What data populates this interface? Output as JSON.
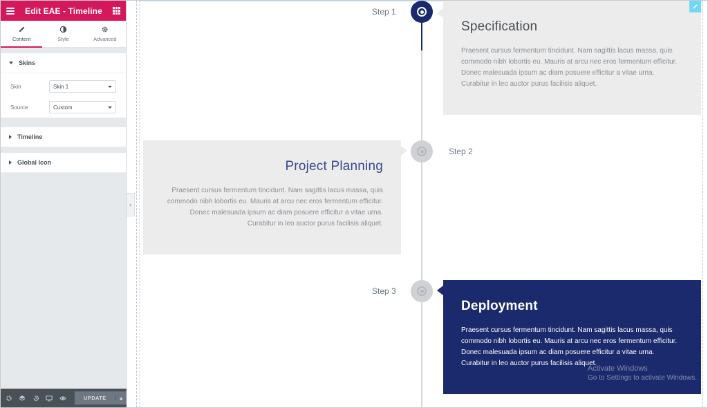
{
  "sidebar": {
    "title": "Edit EAE - Timeline",
    "tabs": [
      {
        "label": "Content",
        "icon": "pencil-icon"
      },
      {
        "label": "Style",
        "icon": "half-circle-icon"
      },
      {
        "label": "Advanced",
        "icon": "gear-icon"
      }
    ],
    "sections": {
      "skins": {
        "heading": "Skins",
        "controls": {
          "skin": {
            "label": "Skin",
            "value": "Skin 1"
          },
          "source": {
            "label": "Source",
            "value": "Custom"
          }
        }
      },
      "timeline": {
        "heading": "Timeline"
      },
      "global_icon": {
        "heading": "Global Icon"
      }
    },
    "footer": {
      "update_label": "UPDATE",
      "icons": [
        "gear-icon",
        "layers-icon",
        "history-icon",
        "desktop-icon",
        "eye-icon"
      ]
    }
  },
  "timeline": {
    "items": [
      {
        "step": "Step 1",
        "title": "Specification",
        "text": "Praesent cursus fermentum tincidunt. Nam sagittis lacus massa, quis commodo nibh lobortis eu. Mauris at arcu nec eros fermentum efficitur. Donec malesuada ipsum ac diam posuere efficitur a vitae urna. Curabitur in leo auctor purus facilisis aliquet."
      },
      {
        "step": "Step 2",
        "title": "Project Planning",
        "text": "Praesent cursus fermentum tincidunt. Nam sagittis lacus massa, quis commodo nibh lobortis eu. Mauris at arcu nec eros fermentum efficitur. Donec malesuada ipsum ac diam posuere efficitur a vitae urna. Curabitur in leo auctor purus facilisis aliquet."
      },
      {
        "step": "Step 3",
        "title": "Deployment",
        "text": "Praesent cursus fermentum tincidunt. Nam sagittis lacus massa, quis commodo nibh lobortis eu. Mauris at arcu nec eros fermentum efficitur. Donec malesuada ipsum ac diam posuere efficitur a vitae urna. Curabitur in leo auctor purus facilisis aliquet."
      }
    ]
  },
  "watermark": {
    "line1": "Activate Windows",
    "line2": "Go to Settings to activate Windows."
  },
  "colors": {
    "accent": "#d5175b",
    "navy": "#1a2a6c",
    "card_gray": "#ececec",
    "edit_badge": "#71d7f7"
  }
}
